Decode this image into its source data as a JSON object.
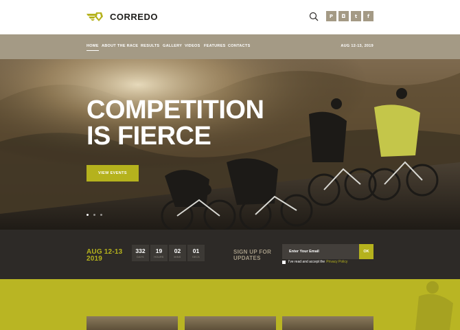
{
  "brand": {
    "name": "CORREDO"
  },
  "header": {
    "social": [
      {
        "icon": "pinterest-icon",
        "glyph": "P"
      },
      {
        "icon": "instagram-icon",
        "glyph": "◘"
      },
      {
        "icon": "twitter-icon",
        "glyph": "t"
      },
      {
        "icon": "facebook-icon",
        "glyph": "f"
      }
    ]
  },
  "nav": {
    "items": [
      "HOME",
      "ABOUT THE RACE",
      "RESULTS",
      "GALLERY",
      "VIDEOS",
      "FEATURES",
      "CONTACTS"
    ],
    "active": "HOME",
    "date": "AUG 12-13, 2019"
  },
  "hero": {
    "title_line1": "COMPETITION",
    "title_line2": "IS FIERCE",
    "button": "VIEW EVENTS",
    "slides": 3,
    "active_slide": 1
  },
  "countdown": {
    "date_line1": "AUG 12-13",
    "date_line2": "2019",
    "units": [
      {
        "value": "332",
        "label": "DAYS"
      },
      {
        "value": "19",
        "label": "HOURS"
      },
      {
        "value": "02",
        "label": "MINS"
      },
      {
        "value": "01",
        "label": "SECS"
      }
    ]
  },
  "signup": {
    "title_line1": "SIGN UP FOR",
    "title_line2": "UPDATES",
    "placeholder": "Enter Your Email",
    "button": "OK",
    "consent": "I've read and accept the",
    "consent_link": "Privacy Policy"
  },
  "colors": {
    "accent": "#b5b21d",
    "taupe": "#a49a85",
    "dark": "#2d2a27"
  }
}
